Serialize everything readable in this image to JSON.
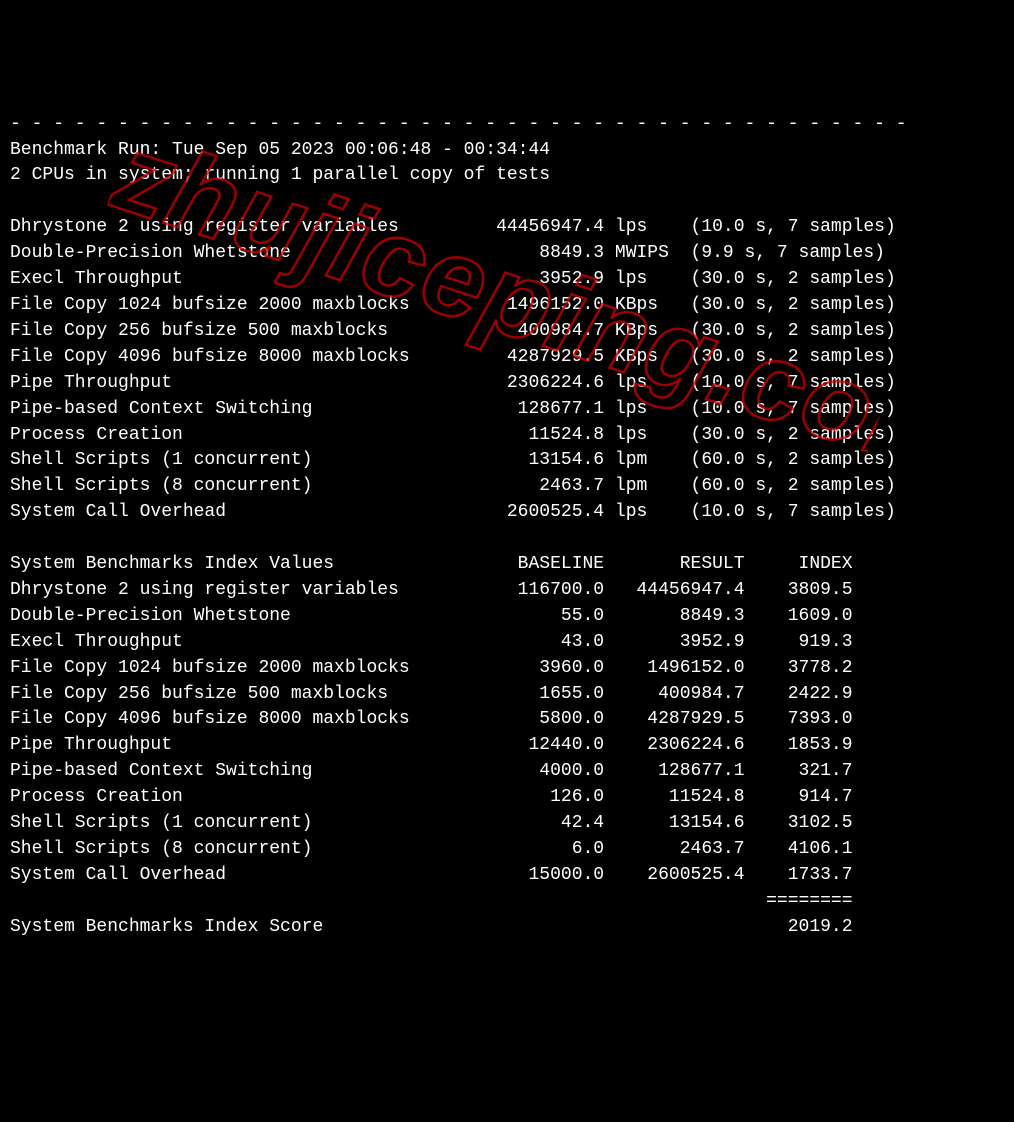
{
  "dashes": "- - - - - - - - - - - - - - - - - - - - - - - - - - - - - - - - - - - - - - - - - -",
  "run_header": "Benchmark Run: Tue Sep 05 2023 00:06:48 - 00:34:44",
  "cpu_line": "2 CPUs in system; running 1 parallel copy of tests",
  "tests": [
    {
      "name": "Dhrystone 2 using register variables",
      "value": "44456947.4",
      "unit": "lps",
      "timing": "(10.0 s, 7 samples)"
    },
    {
      "name": "Double-Precision Whetstone",
      "value": "8849.3",
      "unit": "MWIPS",
      "timing": "(9.9 s, 7 samples)"
    },
    {
      "name": "Execl Throughput",
      "value": "3952.9",
      "unit": "lps",
      "timing": "(30.0 s, 2 samples)"
    },
    {
      "name": "File Copy 1024 bufsize 2000 maxblocks",
      "value": "1496152.0",
      "unit": "KBps",
      "timing": "(30.0 s, 2 samples)"
    },
    {
      "name": "File Copy 256 bufsize 500 maxblocks",
      "value": "400984.7",
      "unit": "KBps",
      "timing": "(30.0 s, 2 samples)"
    },
    {
      "name": "File Copy 4096 bufsize 8000 maxblocks",
      "value": "4287929.5",
      "unit": "KBps",
      "timing": "(30.0 s, 2 samples)"
    },
    {
      "name": "Pipe Throughput",
      "value": "2306224.6",
      "unit": "lps",
      "timing": "(10.0 s, 7 samples)"
    },
    {
      "name": "Pipe-based Context Switching",
      "value": "128677.1",
      "unit": "lps",
      "timing": "(10.0 s, 7 samples)"
    },
    {
      "name": "Process Creation",
      "value": "11524.8",
      "unit": "lps",
      "timing": "(30.0 s, 2 samples)"
    },
    {
      "name": "Shell Scripts (1 concurrent)",
      "value": "13154.6",
      "unit": "lpm",
      "timing": "(60.0 s, 2 samples)"
    },
    {
      "name": "Shell Scripts (8 concurrent)",
      "value": "2463.7",
      "unit": "lpm",
      "timing": "(60.0 s, 2 samples)"
    },
    {
      "name": "System Call Overhead",
      "value": "2600525.4",
      "unit": "lps",
      "timing": "(10.0 s, 7 samples)"
    }
  ],
  "index_header": {
    "title": "System Benchmarks Index Values",
    "col1": "BASELINE",
    "col2": "RESULT",
    "col3": "INDEX"
  },
  "index_rows": [
    {
      "name": "Dhrystone 2 using register variables",
      "baseline": "116700.0",
      "result": "44456947.4",
      "index": "3809.5"
    },
    {
      "name": "Double-Precision Whetstone",
      "baseline": "55.0",
      "result": "8849.3",
      "index": "1609.0"
    },
    {
      "name": "Execl Throughput",
      "baseline": "43.0",
      "result": "3952.9",
      "index": "919.3"
    },
    {
      "name": "File Copy 1024 bufsize 2000 maxblocks",
      "baseline": "3960.0",
      "result": "1496152.0",
      "index": "3778.2"
    },
    {
      "name": "File Copy 256 bufsize 500 maxblocks",
      "baseline": "1655.0",
      "result": "400984.7",
      "index": "2422.9"
    },
    {
      "name": "File Copy 4096 bufsize 8000 maxblocks",
      "baseline": "5800.0",
      "result": "4287929.5",
      "index": "7393.0"
    },
    {
      "name": "Pipe Throughput",
      "baseline": "12440.0",
      "result": "2306224.6",
      "index": "1853.9"
    },
    {
      "name": "Pipe-based Context Switching",
      "baseline": "4000.0",
      "result": "128677.1",
      "index": "321.7"
    },
    {
      "name": "Process Creation",
      "baseline": "126.0",
      "result": "11524.8",
      "index": "914.7"
    },
    {
      "name": "Shell Scripts (1 concurrent)",
      "baseline": "42.4",
      "result": "13154.6",
      "index": "3102.5"
    },
    {
      "name": "Shell Scripts (8 concurrent)",
      "baseline": "6.0",
      "result": "2463.7",
      "index": "4106.1"
    },
    {
      "name": "System Call Overhead",
      "baseline": "15000.0",
      "result": "2600525.4",
      "index": "1733.7"
    }
  ],
  "separator": "========",
  "score_label": "System Benchmarks Index Score",
  "score_value": "2019.2",
  "watermark": "zhujiceping.com"
}
